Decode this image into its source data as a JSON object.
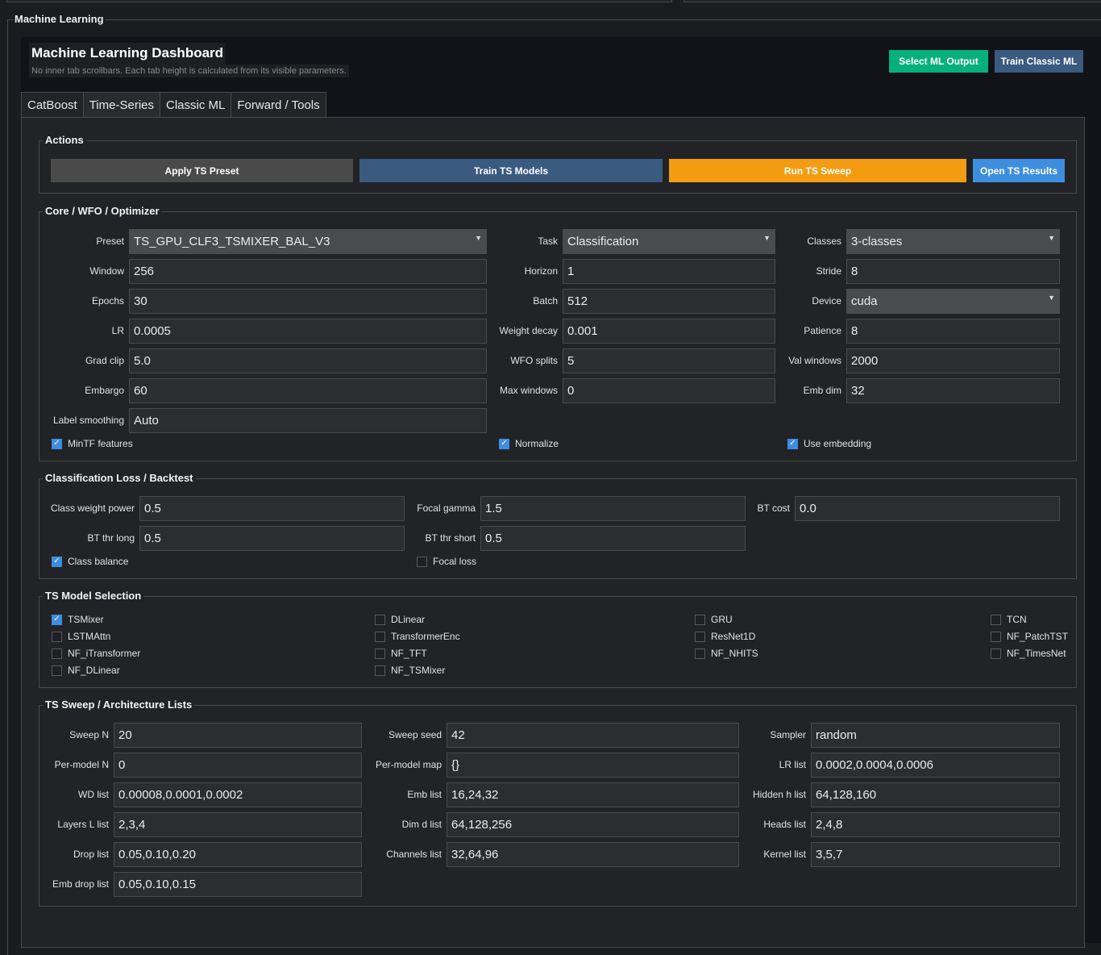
{
  "window": {
    "section_title": "Machine Learning"
  },
  "header": {
    "title": "Machine Learning Dashboard",
    "subtitle": "No inner tab scrollbars. Each tab height is calculated from its visible parameters.",
    "select_output": "Select ML Output",
    "train_classic": "Train Classic ML"
  },
  "tabs": [
    "CatBoost",
    "Time-Series",
    "Classic ML",
    "Forward / Tools"
  ],
  "active_tab": "Time-Series",
  "actions": {
    "title": "Actions",
    "apply_preset": "Apply TS Preset",
    "train_models": "Train TS Models",
    "run_sweep": "Run TS Sweep",
    "open_results": "Open TS Results"
  },
  "core": {
    "title": "Core / WFO / Optimizer",
    "preset": {
      "label": "Preset",
      "value": "TS_GPU_CLF3_TSMIXER_BAL_V3"
    },
    "task": {
      "label": "Task",
      "value": "Classification"
    },
    "classes": {
      "label": "Classes",
      "value": "3-classes"
    },
    "window": {
      "label": "Window",
      "value": "256"
    },
    "horizon": {
      "label": "Horizon",
      "value": "1"
    },
    "stride": {
      "label": "Stride",
      "value": "8"
    },
    "epochs": {
      "label": "Epochs",
      "value": "30"
    },
    "batch": {
      "label": "Batch",
      "value": "512"
    },
    "device": {
      "label": "Device",
      "value": "cuda"
    },
    "lr": {
      "label": "LR",
      "value": "0.0005"
    },
    "weight_decay": {
      "label": "Weight decay",
      "value": "0.001"
    },
    "patience": {
      "label": "Patience",
      "value": "8"
    },
    "grad_clip": {
      "label": "Grad clip",
      "value": "5.0"
    },
    "wfo_splits": {
      "label": "WFO splits",
      "value": "5"
    },
    "val_windows": {
      "label": "Val windows",
      "value": "2000"
    },
    "embargo": {
      "label": "Embargo",
      "value": "60"
    },
    "max_windows": {
      "label": "Max windows",
      "value": "0"
    },
    "emb_dim": {
      "label": "Emb dim",
      "value": "32"
    },
    "label_smoothing": {
      "label": "Label smoothing",
      "value": "Auto"
    },
    "mintf": {
      "label": "MinTF features",
      "checked": true
    },
    "normalize": {
      "label": "Normalize",
      "checked": true
    },
    "use_embedding": {
      "label": "Use embedding",
      "checked": true
    }
  },
  "loss": {
    "title": "Classification Loss / Backtest",
    "class_weight_power": {
      "label": "Class weight power",
      "value": "0.5"
    },
    "focal_gamma": {
      "label": "Focal gamma",
      "value": "1.5"
    },
    "bt_cost": {
      "label": "BT cost",
      "value": "0.0"
    },
    "bt_thr_long": {
      "label": "BT thr long",
      "value": "0.5"
    },
    "bt_thr_short": {
      "label": "BT thr short",
      "value": "0.5"
    },
    "class_balance": {
      "label": "Class balance",
      "checked": true
    },
    "focal_loss": {
      "label": "Focal loss",
      "checked": false
    }
  },
  "models": {
    "title": "TS Model Selection",
    "items": [
      {
        "label": "TSMixer",
        "checked": true
      },
      {
        "label": "DLinear",
        "checked": false
      },
      {
        "label": "GRU",
        "checked": false
      },
      {
        "label": "TCN",
        "checked": false
      },
      {
        "label": "LSTMAttn",
        "checked": false
      },
      {
        "label": "TransformerEnc",
        "checked": false
      },
      {
        "label": "ResNet1D",
        "checked": false
      },
      {
        "label": "NF_PatchTST",
        "checked": false
      },
      {
        "label": "NF_iTransformer",
        "checked": false
      },
      {
        "label": "NF_TFT",
        "checked": false
      },
      {
        "label": "NF_NHITS",
        "checked": false
      },
      {
        "label": "NF_TimesNet",
        "checked": false
      },
      {
        "label": "NF_DLinear",
        "checked": false
      },
      {
        "label": "NF_TSMixer",
        "checked": false
      }
    ]
  },
  "sweep": {
    "title": "TS Sweep / Architecture Lists",
    "sweep_n": {
      "label": "Sweep N",
      "value": "20"
    },
    "sweep_seed": {
      "label": "Sweep seed",
      "value": "42"
    },
    "sampler": {
      "label": "Sampler",
      "value": "random"
    },
    "per_model_n": {
      "label": "Per-model N",
      "value": "0"
    },
    "per_model_map": {
      "label": "Per-model map",
      "value": "{}"
    },
    "lr_list": {
      "label": "LR list",
      "value": "0.0002,0.0004,0.0006"
    },
    "wd_list": {
      "label": "WD list",
      "value": "0.00008,0.0001,0.0002"
    },
    "emb_list": {
      "label": "Emb list",
      "value": "16,24,32"
    },
    "hidden_list": {
      "label": "Hidden h list",
      "value": "64,128,160"
    },
    "layers_list": {
      "label": "Layers L list",
      "value": "2,3,4"
    },
    "dim_list": {
      "label": "Dim d list",
      "value": "64,128,256"
    },
    "heads_list": {
      "label": "Heads list",
      "value": "2,4,8"
    },
    "drop_list": {
      "label": "Drop list",
      "value": "0.05,0.10,0.20"
    },
    "channels_list": {
      "label": "Channels list",
      "value": "32,64,96"
    },
    "kernel_list": {
      "label": "Kernel list",
      "value": "3,5,7"
    },
    "emb_drop_list": {
      "label": "Emb drop list",
      "value": "0.05,0.10,0.15"
    }
  },
  "colors": {
    "green": "#06b07c",
    "blue": "#3a5a80",
    "orange": "#f39c12",
    "light_blue": "#3d8ee0",
    "gray_button": "#4a4a4a"
  }
}
